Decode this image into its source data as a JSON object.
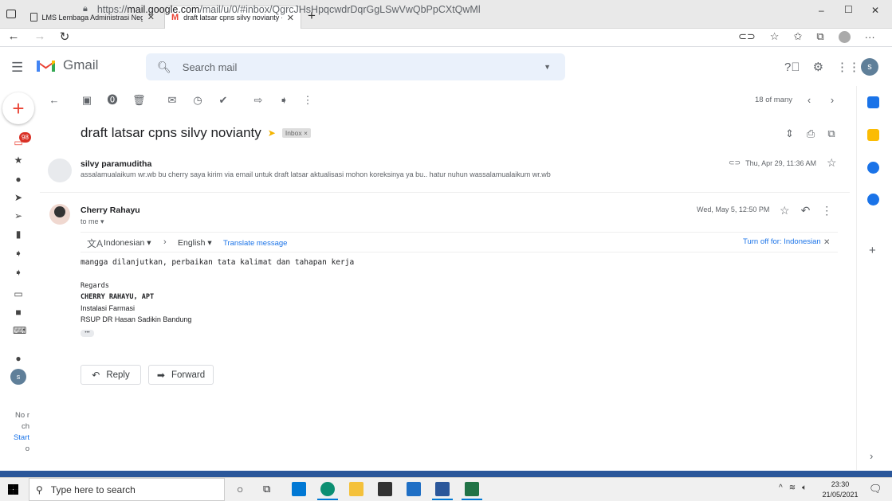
{
  "browser": {
    "tabs": [
      {
        "title": "LMS Lembaga Administrasi Neg"
      },
      {
        "title": "draft latsar cpns silvy novianty -"
      }
    ],
    "url_prefix": "https://",
    "url_domain": "mail.google.com",
    "url_path": "/mail/u/0/#inbox/QgrcJHsHpqcwdrDqrGgLSwVwQbPpCXtQwMl",
    "window_controls": {
      "minimize": "–",
      "maximize": "☐",
      "close": "✕"
    }
  },
  "gmail": {
    "brand": "Gmail",
    "search_placeholder": "Search mail",
    "avatar_letter": "s",
    "inbox_badge": "98",
    "page_count": "18 of many",
    "subject": "draft latsar cpns silvy novianty",
    "label_chip": "Inbox ×",
    "messages": [
      {
        "sender": "silvy paramuditha",
        "snippet": "assalamualaikum wr.wb bu cherry saya kirim via email untuk draft latsar aktualisasi mohon koreksinya ya bu.. hatur nuhun wassalamualaikum wr.wb",
        "date": "Thu, Apr 29, 11:36 AM"
      },
      {
        "sender": "Cherry Rahayu",
        "to": "to me ▾",
        "date": "Wed, May 5, 12:50 PM",
        "translate_from": "Indonesian ▾",
        "translate_to": "English ▾",
        "translate_link": "Translate message",
        "turn_off": "Turn off for: Indonesian",
        "body": "mangga dilanjutkan, perbaikan tata kalimat dan tahapan kerja",
        "signature": [
          "Regards",
          "CHERRY RAHAYU, APT",
          "Instalasi Farmasi",
          "RSUP DR Hasan Sadikin Bandung"
        ],
        "ellipsis": "•••"
      }
    ],
    "reply_label": "Reply",
    "forward_label": "Forward",
    "hangouts_text": [
      "No r",
      "ch",
      "Start",
      "o"
    ]
  },
  "taskbar": {
    "search_placeholder": "Type here to search",
    "time": "23:30",
    "date": "21/05/2021"
  },
  "colors": {
    "gmail_red": "#ea4335",
    "link_blue": "#1a73e8",
    "search_bg": "#eaf1fb",
    "word_blue": "#2b579a",
    "excel_green": "#217346"
  }
}
